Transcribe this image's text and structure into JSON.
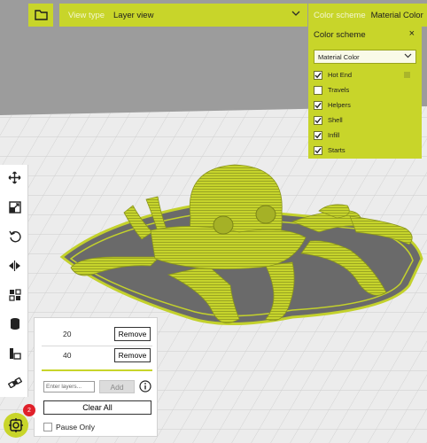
{
  "viewtype": {
    "label": "View type",
    "value": "Layer view"
  },
  "color_scheme": {
    "bar_label": "Color scheme",
    "bar_value": "Material Color",
    "panel_title": "Color scheme",
    "close_glyph": "×",
    "dropdown_value": "Material Color",
    "options": [
      {
        "label": "Hot End",
        "checked": true
      },
      {
        "label": "Travels",
        "checked": false
      },
      {
        "label": "Helpers",
        "checked": true
      },
      {
        "label": "Shell",
        "checked": true
      },
      {
        "label": "Infill",
        "checked": true
      },
      {
        "label": "Starts",
        "checked": true
      }
    ]
  },
  "layers": {
    "rows": [
      {
        "value": "20",
        "remove_label": "Remove"
      },
      {
        "value": "40",
        "remove_label": "Remove"
      }
    ],
    "input_placeholder": "Enter layers...",
    "add_label": "Add",
    "clear_label": "Clear All",
    "pause_label": "Pause Only"
  },
  "plugin_badge": "2",
  "colors": {
    "accent": "#c8d52a",
    "model": "#c3d12c",
    "buildplate": "#ececec",
    "badge": "#e0212a"
  }
}
